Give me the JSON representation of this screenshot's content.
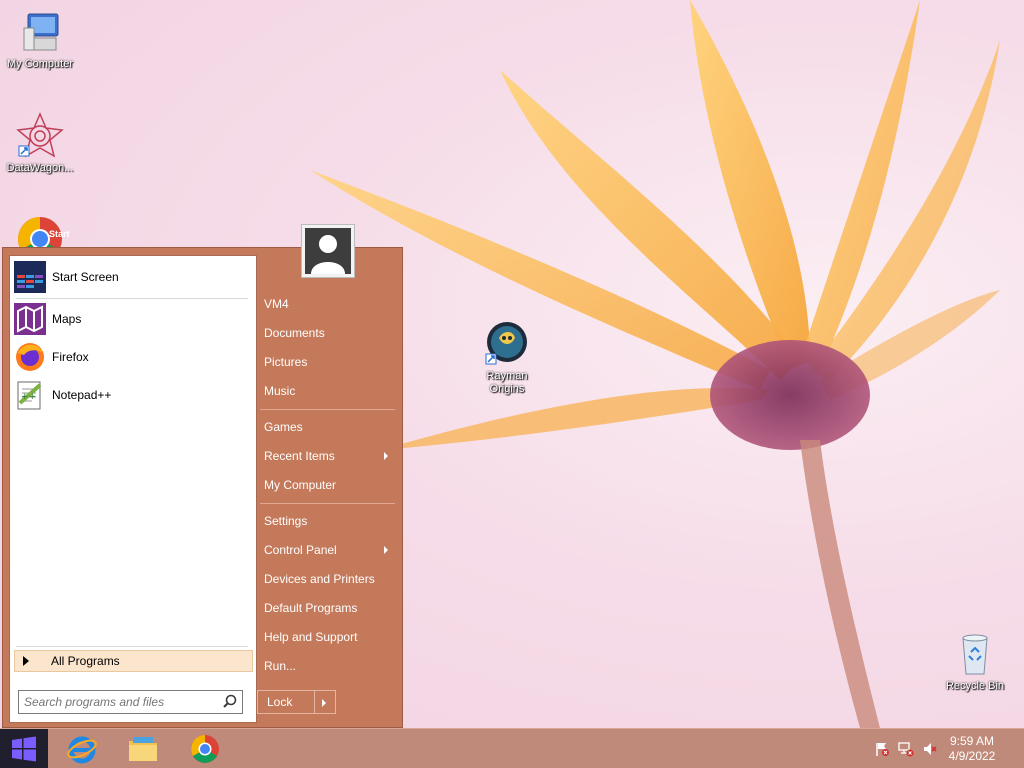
{
  "desktop": {
    "icons": [
      {
        "label": "My Computer"
      },
      {
        "label": "DataWagon..."
      },
      {
        "label": "Rayman Origins"
      },
      {
        "label": "Recycle Bin"
      }
    ]
  },
  "start_menu": {
    "programs": [
      {
        "label": "Start Screen",
        "icon": "start-screen-icon"
      },
      {
        "label": "Maps",
        "icon": "maps-icon"
      },
      {
        "label": "Firefox",
        "icon": "firefox-icon"
      },
      {
        "label": "Notepad++",
        "icon": "notepad-plus-plus-icon"
      }
    ],
    "start_screen_badge": "Start",
    "all_programs_label": "All Programs",
    "search_placeholder": "Search programs and files",
    "right_items": [
      {
        "label": "VM4"
      },
      {
        "label": "Documents"
      },
      {
        "label": "Pictures"
      },
      {
        "label": "Music"
      },
      {
        "label": "Games"
      },
      {
        "label": "Recent Items"
      },
      {
        "label": "My Computer"
      },
      {
        "label": "Settings"
      },
      {
        "label": "Control Panel"
      },
      {
        "label": "Devices and Printers"
      },
      {
        "label": "Default Programs"
      },
      {
        "label": "Help and Support"
      },
      {
        "label": "Run..."
      }
    ],
    "lock_label": "Lock"
  },
  "taskbar": {
    "pinned": [
      "internet-explorer-icon",
      "file-explorer-icon",
      "chrome-icon"
    ],
    "clock": {
      "time": "9:59 AM",
      "date": "4/9/2022"
    }
  },
  "colors": {
    "menu_bg": "#c4795a",
    "taskbar_bg": "#c08a7a",
    "highlight": "#fbe5cc"
  }
}
